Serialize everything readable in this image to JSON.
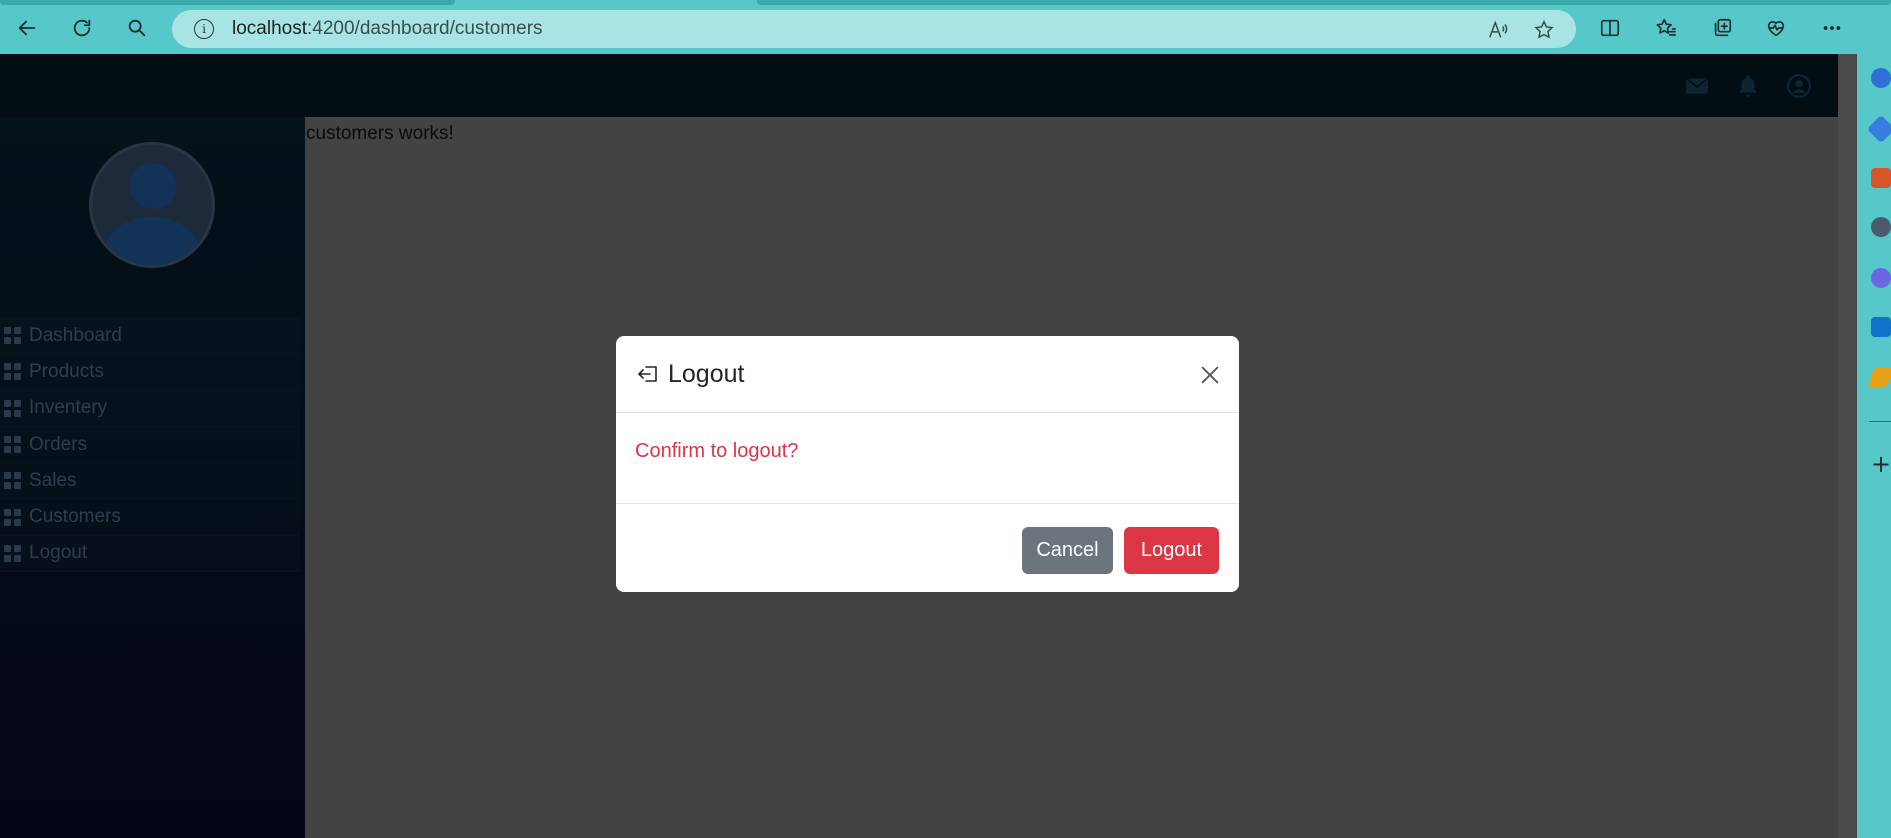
{
  "browser": {
    "url_host": "localhost",
    "url_path": ":4200/dashboard/customers",
    "toolbar_icons": [
      "back-arrow-icon",
      "refresh-icon",
      "search-icon",
      "read-aloud-icon",
      "favorite-star-icon",
      "split-screen-icon",
      "favorites-icon",
      "collections-icon",
      "browser-essentials-icon",
      "more-icon"
    ]
  },
  "header": {
    "icons": [
      "mail-icon",
      "bell-icon",
      "account-icon"
    ]
  },
  "sidebar": {
    "items": [
      {
        "label": "Dashboard"
      },
      {
        "label": "Products"
      },
      {
        "label": "Inventery"
      },
      {
        "label": "Orders"
      },
      {
        "label": "Sales"
      },
      {
        "label": "Customers"
      },
      {
        "label": "Logout"
      }
    ]
  },
  "main": {
    "content_text": "customers works!"
  },
  "modal": {
    "title": "Logout",
    "message": "Confirm to logout?",
    "cancel_label": "Cancel",
    "confirm_label": "Logout"
  },
  "colors": {
    "browser_chrome": "#56c8c9",
    "header_bg": "#020d14",
    "danger": "#dc3545",
    "secondary": "#6c757d"
  }
}
